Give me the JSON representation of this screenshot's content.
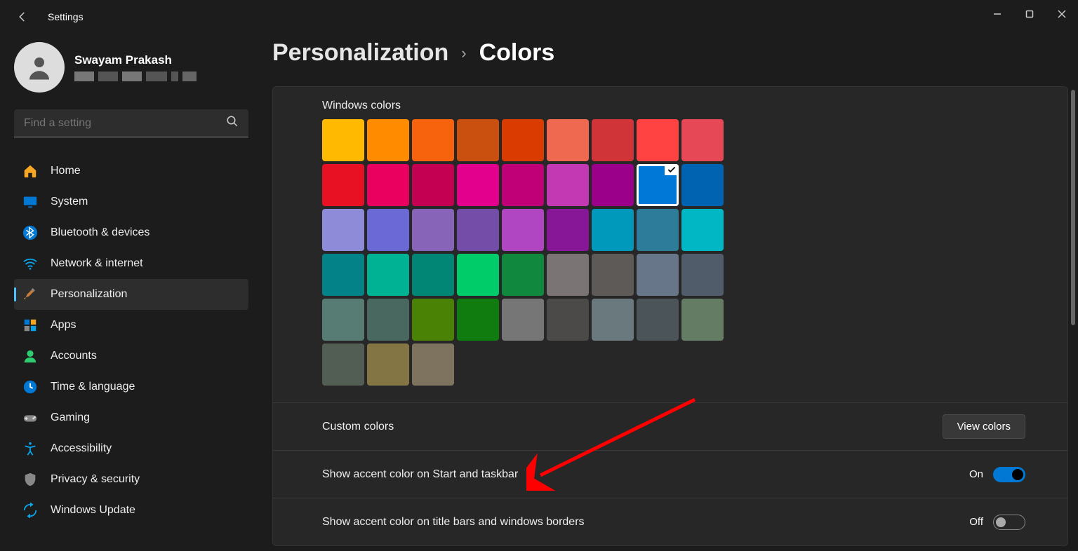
{
  "titlebar": {
    "title": "Settings"
  },
  "profile": {
    "name": "Swayam Prakash"
  },
  "search": {
    "placeholder": "Find a setting"
  },
  "nav": {
    "items": [
      {
        "label": "Home",
        "icon": "home",
        "active": false
      },
      {
        "label": "System",
        "icon": "display",
        "active": false
      },
      {
        "label": "Bluetooth & devices",
        "icon": "bluetooth",
        "active": false
      },
      {
        "label": "Network & internet",
        "icon": "wifi",
        "active": false
      },
      {
        "label": "Personalization",
        "icon": "brush",
        "active": true
      },
      {
        "label": "Apps",
        "icon": "apps",
        "active": false
      },
      {
        "label": "Accounts",
        "icon": "user",
        "active": false
      },
      {
        "label": "Time & language",
        "icon": "clock",
        "active": false
      },
      {
        "label": "Gaming",
        "icon": "gamepad",
        "active": false
      },
      {
        "label": "Accessibility",
        "icon": "accessibility",
        "active": false
      },
      {
        "label": "Privacy & security",
        "icon": "shield",
        "active": false
      },
      {
        "label": "Windows Update",
        "icon": "update",
        "active": false
      }
    ]
  },
  "breadcrumb": {
    "parent": "Personalization",
    "current": "Colors"
  },
  "colors_section": {
    "label": "Windows colors",
    "selected_index": 16,
    "swatches": [
      "#ffb900",
      "#ff8c00",
      "#f7630c",
      "#ca5010",
      "#da3b01",
      "#ef6950",
      "#d13438",
      "#ff4343",
      "#e74856",
      "#e81123",
      "#ea005e",
      "#c30052",
      "#e3008c",
      "#bf0077",
      "#c239b3",
      "#9a0089",
      "#0078d7",
      "#0063b1",
      "#8e8cd8",
      "#6b69d6",
      "#8764b8",
      "#744da9",
      "#b146c2",
      "#881798",
      "#0099bc",
      "#2d7d9a",
      "#00b7c3",
      "#038387",
      "#00b294",
      "#018574",
      "#00cc6a",
      "#10893e",
      "#7a7574",
      "#5d5a58",
      "#68768a",
      "#515c6b",
      "#567c73",
      "#486860",
      "#498205",
      "#107c10",
      "#767676",
      "#4c4a48",
      "#69797e",
      "#4a5459",
      "#647c64",
      "#525e54",
      "#847545",
      "#7e735f"
    ]
  },
  "custom_colors_row": {
    "label": "Custom colors",
    "button": "View colors"
  },
  "start_taskbar_row": {
    "label": "Show accent color on Start and taskbar",
    "state": "On",
    "on": true
  },
  "titlebars_row": {
    "label": "Show accent color on title bars and windows borders",
    "state": "Off",
    "on": false
  }
}
